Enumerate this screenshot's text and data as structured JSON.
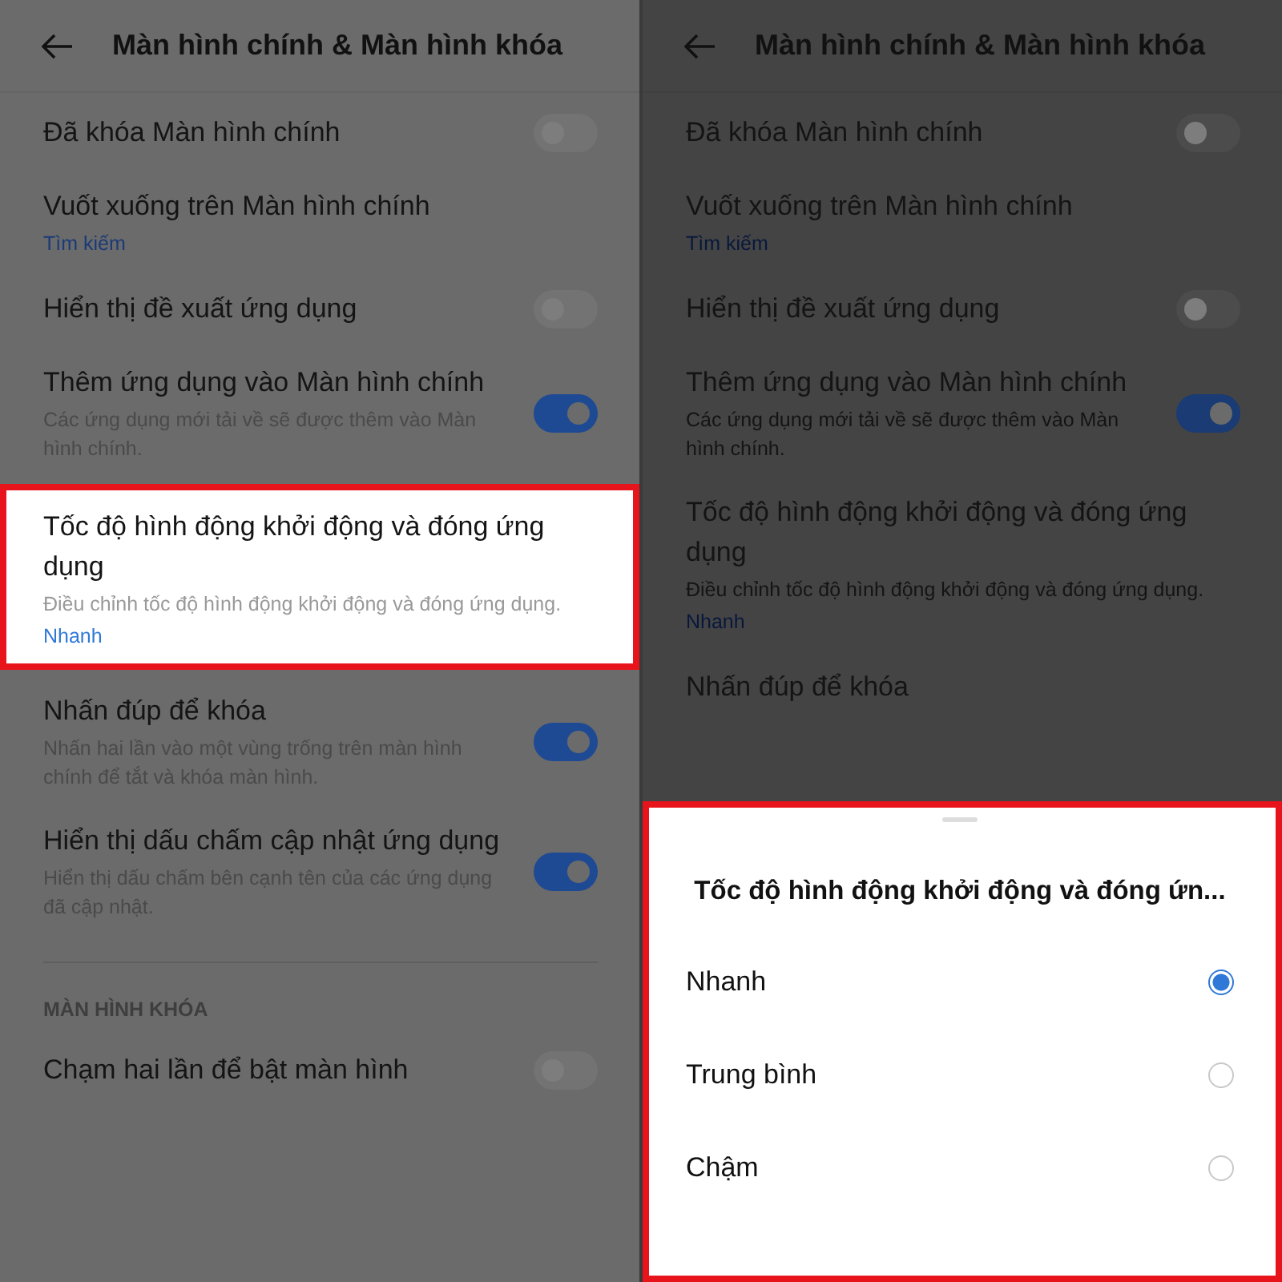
{
  "panes": [
    {
      "dimmed": false,
      "header": {
        "title": "Màn hình chính & Màn hình khóa"
      },
      "items": [
        {
          "kind": "toggle",
          "title": "Đã khóa Màn hình chính",
          "on": false,
          "highlighted": false
        },
        {
          "kind": "value",
          "title": "Vuốt xuống trên Màn hình chính",
          "value": "Tìm kiếm",
          "highlighted": false
        },
        {
          "kind": "toggle",
          "title": "Hiển thị đề xuất ứng dụng",
          "on": false,
          "highlighted": false
        },
        {
          "kind": "toggle",
          "title": "Thêm ứng dụng vào Màn hình chính",
          "description": "Các ứng dụng mới tải về sẽ được thêm vào Màn hình chính.",
          "on": true,
          "highlighted": false
        },
        {
          "kind": "value",
          "title": "Tốc độ hình động khởi động và đóng ứng dụng",
          "description": "Điều chỉnh tốc độ hình động khởi động và đóng ứng dụng.",
          "value": "Nhanh",
          "highlighted": true
        },
        {
          "kind": "toggle",
          "title": "Nhấn đúp để khóa",
          "description": "Nhấn hai lần vào một vùng trống trên màn hình chính để tắt và khóa màn hình.",
          "on": true,
          "highlighted": false
        },
        {
          "kind": "toggle",
          "title": "Hiển thị dấu chấm cập nhật ứng dụng",
          "description": "Hiển thị dấu chấm bên cạnh tên của các ứng dụng đã cập nhật.",
          "on": true,
          "highlighted": false
        },
        {
          "kind": "section",
          "title": "MÀN HÌNH KHÓA"
        },
        {
          "kind": "toggle",
          "title": "Chạm hai lần để bật màn hình",
          "on": false,
          "highlighted": false
        }
      ]
    },
    {
      "dimmed": true,
      "header": {
        "title": "Màn hình chính & Màn hình khóa"
      },
      "items": [
        {
          "kind": "toggle",
          "title": "Đã khóa Màn hình chính",
          "on": false,
          "highlighted": false
        },
        {
          "kind": "value",
          "title": "Vuốt xuống trên Màn hình chính",
          "value": "Tìm kiếm",
          "highlighted": false
        },
        {
          "kind": "toggle",
          "title": "Hiển thị đề xuất ứng dụng",
          "on": false,
          "highlighted": false
        },
        {
          "kind": "toggle",
          "title": "Thêm ứng dụng vào Màn hình chính",
          "description": "Các ứng dụng mới tải về sẽ được thêm vào Màn hình chính.",
          "on": true,
          "highlighted": false
        },
        {
          "kind": "value",
          "title": "Tốc độ hình động khởi động và đóng ứng dụng",
          "description": "Điều chỉnh tốc độ hình động khởi động và đóng ứng dụng.",
          "value": "Nhanh",
          "highlighted": false
        },
        {
          "kind": "plain",
          "title": "Nhấn đúp để khóa",
          "highlighted": false
        }
      ],
      "sheet": {
        "title": "Tốc độ hình động khởi động và đóng ứn...",
        "highlighted": true,
        "options": [
          {
            "label": "Nhanh",
            "selected": true
          },
          {
            "label": "Trung bình",
            "selected": false
          },
          {
            "label": "Chậm",
            "selected": false
          }
        ]
      }
    }
  ]
}
